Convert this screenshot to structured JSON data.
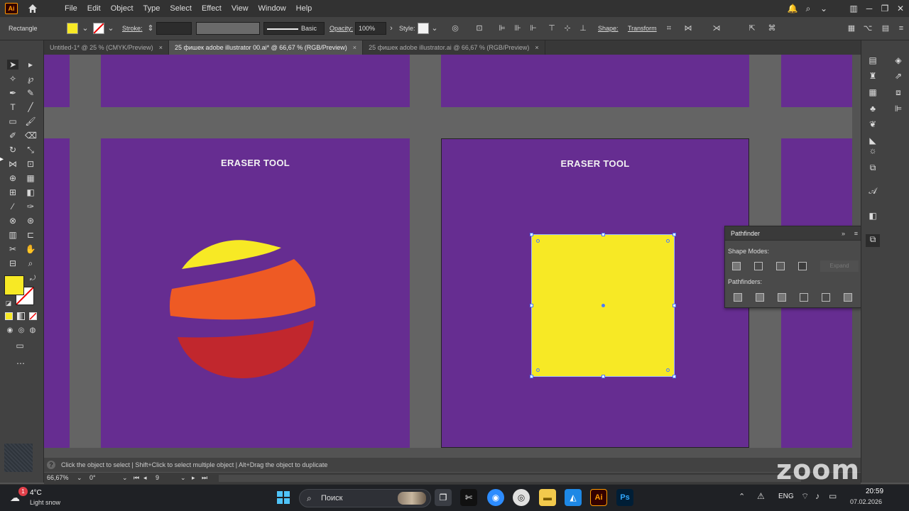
{
  "app": {
    "logo_text": "Ai"
  },
  "menu": [
    "File",
    "Edit",
    "Object",
    "Type",
    "Select",
    "Effect",
    "View",
    "Window",
    "Help"
  ],
  "control_bar": {
    "selection_type": "Rectangle",
    "fill_color": "#f7e925",
    "stroke_label": "Stroke:",
    "brush_label": "Basic",
    "opacity_label": "Opacity:",
    "opacity_value": "100%",
    "style_label": "Style:",
    "shape_label": "Shape:",
    "transform_label": "Transform"
  },
  "tabs": [
    {
      "label": "Untitled-1* @ 25 % (CMYK/Preview)",
      "close": "×"
    },
    {
      "label": "25 фишек adobe illustrator 00.ai* @ 66,67 % (RGB/Preview)",
      "close": "×"
    },
    {
      "label": "25 фишек adobe illustrator.ai @ 66,67 % (RGB/Preview)",
      "close": "×"
    }
  ],
  "artboards": [
    {
      "title": "ERASER TOOL"
    },
    {
      "title": "ERASER TOOL"
    }
  ],
  "colors": {
    "artboard": "#662d91",
    "yellow": "#f7e925",
    "orange": "#ee5a24",
    "red": "#c1272d",
    "canvas": "#646464"
  },
  "pathfinder": {
    "title": "Pathfinder",
    "shape_modes_label": "Shape Modes:",
    "pathfinders_label": "Pathfinders:",
    "expand_label": "Expand"
  },
  "status": {
    "hint": "Click the object to select  |  Shift+Click to select multiple object  |  Alt+Drag the object to duplicate",
    "zoom": "66,67%",
    "rotation": "0°",
    "artboard_number": "9"
  },
  "taskbar": {
    "weather_temp": "4°C",
    "weather_desc": "Light snow",
    "weather_badge": "1",
    "search_placeholder": "Поиск",
    "lang": "ENG",
    "time": "20:59",
    "date": "07.02.2026",
    "zoom_watermark": "zoom"
  }
}
